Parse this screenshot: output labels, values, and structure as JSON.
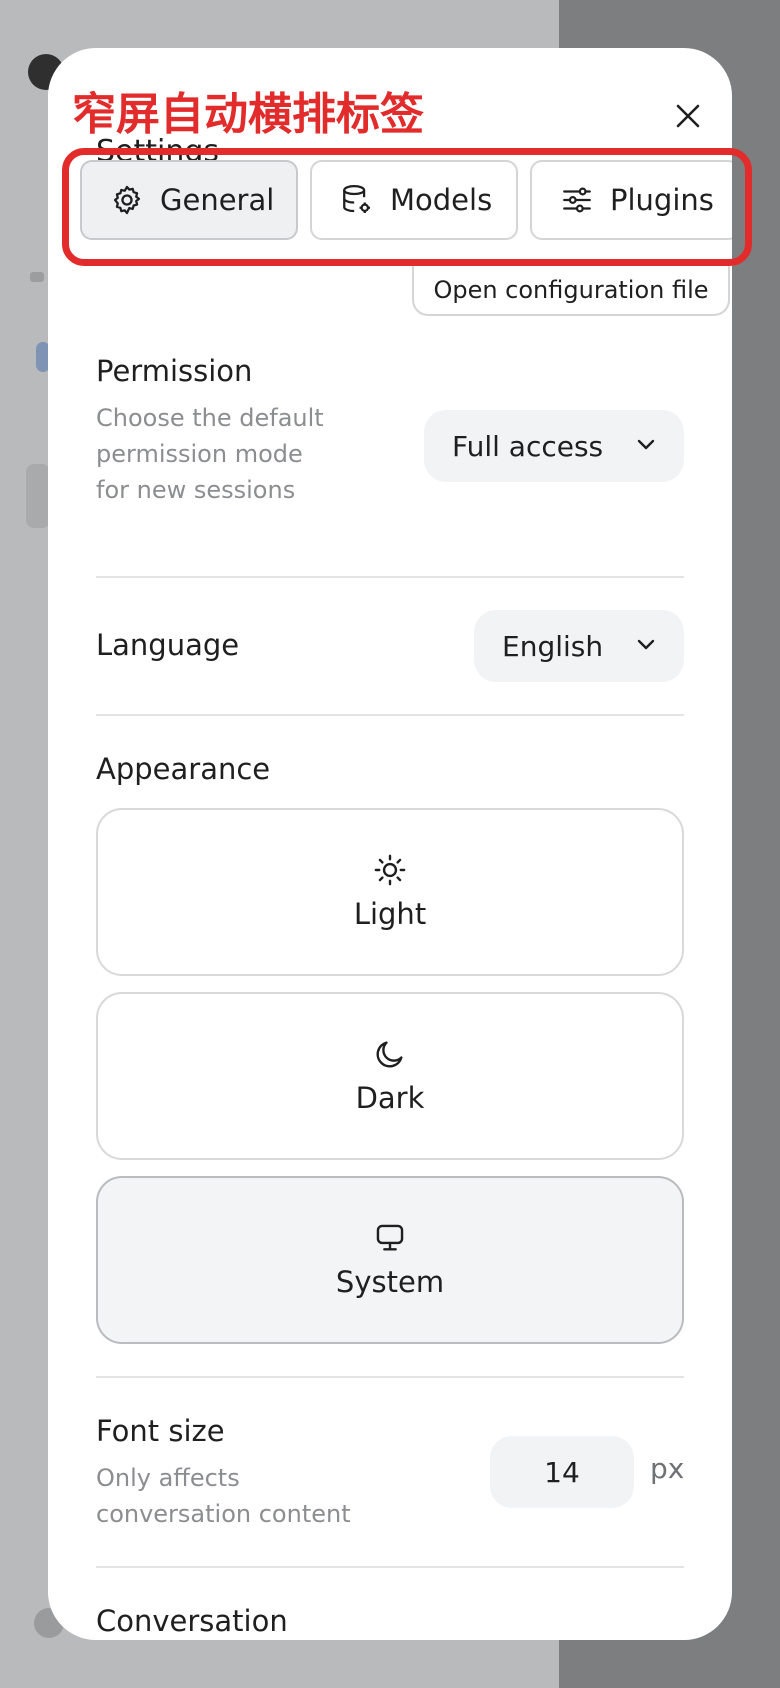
{
  "annotation": {
    "text": "窄屏自动横排标签",
    "color": "#e22b2b"
  },
  "panel": {
    "title": "Settings",
    "close_icon": "close-icon"
  },
  "tabs": [
    {
      "label": "General",
      "icon": "gear-icon",
      "active": true
    },
    {
      "label": "Models",
      "icon": "database-gear-icon",
      "active": false
    },
    {
      "label": "Plugins",
      "icon": "sliders-icon",
      "active": false
    }
  ],
  "open_config_label": "Open configuration file",
  "permission": {
    "label": "Permission",
    "description": "Choose the default permission mode for new sessions",
    "value": "Full access"
  },
  "language": {
    "label": "Language",
    "value": "English"
  },
  "appearance": {
    "label": "Appearance",
    "options": [
      {
        "label": "Light",
        "icon": "sun-icon",
        "selected": false
      },
      {
        "label": "Dark",
        "icon": "moon-icon",
        "selected": false
      },
      {
        "label": "System",
        "icon": "monitor-icon",
        "selected": true
      }
    ]
  },
  "font_size": {
    "label": "Font size",
    "description": "Only affects conversation content",
    "value": "14",
    "unit": "px"
  },
  "conversation": {
    "label": "Conversation"
  },
  "colors": {
    "highlight": "#e22b2b",
    "active_tab_bg": "#eef0f2",
    "select_bg": "#f2f3f5"
  }
}
